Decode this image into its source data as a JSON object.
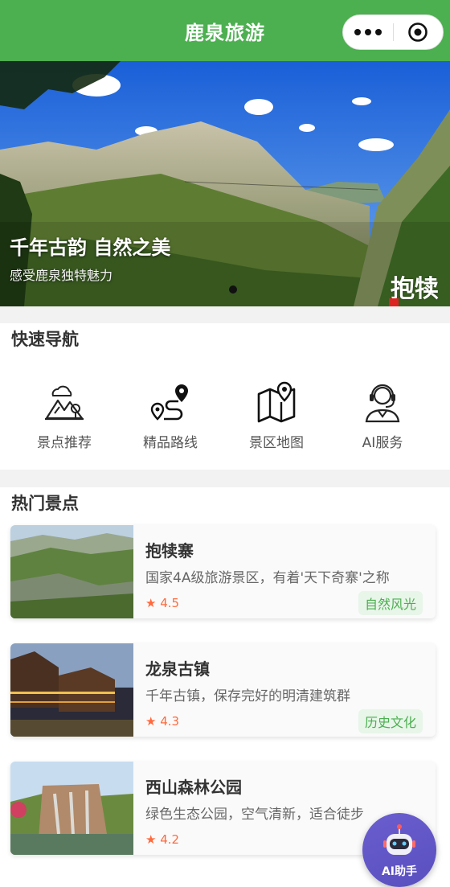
{
  "header": {
    "title": "鹿泉旅游"
  },
  "banner": {
    "title": "千年古韵 自然之美",
    "subtitle": "感受鹿泉独特魅力",
    "watermark_text": "抱犊"
  },
  "quick_nav": {
    "title": "快速导航",
    "items": [
      {
        "label": "景点推荐",
        "icon": "mountain-icon"
      },
      {
        "label": "精品路线",
        "icon": "route-icon"
      },
      {
        "label": "景区地图",
        "icon": "map-icon"
      },
      {
        "label": "AI服务",
        "icon": "headset-agent-icon"
      }
    ]
  },
  "hot_spots": {
    "title": "热门景点",
    "items": [
      {
        "name": "抱犊寨",
        "desc": "国家4A级旅游景区，有着'天下奇寨'之称",
        "rating": "★ 4.5",
        "tag": "自然风光"
      },
      {
        "name": "龙泉古镇",
        "desc": "千年古镇，保存完好的明清建筑群",
        "rating": "★ 4.3",
        "tag": "历史文化"
      },
      {
        "name": "西山森林公园",
        "desc": "绿色生态公园，空气清新，适合徒步",
        "rating": "★ 4.2",
        "tag": ""
      }
    ]
  },
  "ai_helper": {
    "label": "AI助手"
  },
  "colors": {
    "primary": "#4caf50",
    "rating": "#ff6a3d",
    "ai_button": "#5a4fbf"
  }
}
